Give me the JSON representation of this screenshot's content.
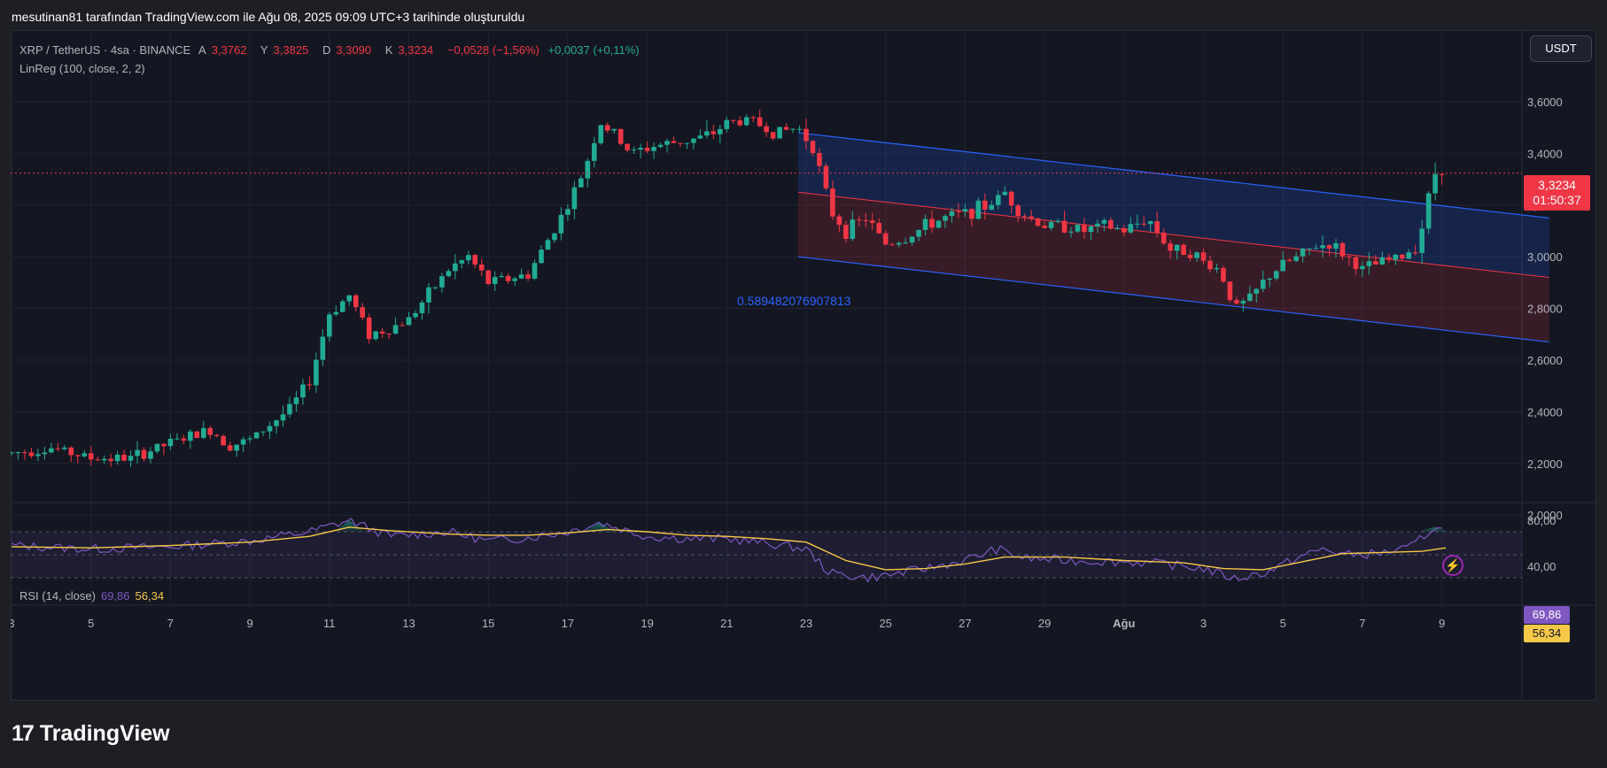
{
  "header": {
    "title": "mesutinan81 tarafından TradingView.com ile Ağu 08, 2025 09:09 UTC+3 tarihinde oluşturuldu"
  },
  "legend": {
    "symbol": "XRP / TetherUS · 4sa · BINANCE",
    "open_label": "A",
    "open": "3,3762",
    "high_label": "Y",
    "high": "3,3825",
    "low_label": "D",
    "low": "3,3090",
    "close_label": "K",
    "close": "3,3234",
    "change": "−0,0528 (−1,56%)",
    "volume_change": "+0,0037 (+0,11%)",
    "indicator": "LinReg (100, close, 2, 2)"
  },
  "currency_button": "USDT",
  "price_tag": {
    "price": "3,3234",
    "countdown": "01:50:37"
  },
  "channel_label": "0.589482076907813",
  "rsi": {
    "label": "RSI (14, close)",
    "value": "69,86",
    "ma": "56,34"
  },
  "footer": {
    "brand": "TradingView",
    "mark": "17"
  },
  "colors": {
    "up": "#22ab94",
    "down": "#f23645",
    "channel": "#2962ff",
    "rsi": "#7e57c2",
    "rsi_ma": "#f7c948",
    "background": "#141722"
  },
  "icons": {
    "alert": "lightning-bolt-icon"
  },
  "chart_data": {
    "type": "candlestick",
    "price_axis": {
      "ticks": [
        "3,6000",
        "3,4000",
        "3,2000",
        "3,0000",
        "2,8000",
        "2,6000",
        "2,4000",
        "2,2000",
        "2,0000"
      ],
      "range": [
        1.97,
        3.7
      ]
    },
    "x_axis": {
      "ticks": [
        "3",
        "5",
        "7",
        "9",
        "11",
        "13",
        "15",
        "17",
        "19",
        "21",
        "23",
        "25",
        "27",
        "29",
        "Ağu",
        "3",
        "5",
        "7",
        "9"
      ]
    },
    "rsi_axis": {
      "ticks": [
        "80,00",
        "40,00"
      ],
      "bands": [
        70,
        30
      ],
      "mid": 50
    },
    "price_path": [
      [
        3.0,
        2.24
      ],
      [
        4.0,
        2.26
      ],
      [
        5.0,
        2.22
      ],
      [
        6.0,
        2.22
      ],
      [
        6.5,
        2.25
      ],
      [
        7.0,
        2.28
      ],
      [
        8.0,
        2.33
      ],
      [
        8.5,
        2.27
      ],
      [
        9.0,
        2.29
      ],
      [
        10.0,
        2.41
      ],
      [
        10.5,
        2.52
      ],
      [
        11.0,
        2.78
      ],
      [
        11.5,
        2.85
      ],
      [
        12.0,
        2.7
      ],
      [
        12.5,
        2.72
      ],
      [
        13.0,
        2.76
      ],
      [
        14.0,
        2.95
      ],
      [
        14.5,
        3.0
      ],
      [
        15.0,
        2.9
      ],
      [
        16.0,
        2.93
      ],
      [
        17.0,
        3.2
      ],
      [
        17.4,
        3.33
      ],
      [
        17.8,
        3.52
      ],
      [
        18.2,
        3.47
      ],
      [
        18.6,
        3.4
      ],
      [
        19.2,
        3.43
      ],
      [
        20.0,
        3.45
      ],
      [
        20.6,
        3.47
      ],
      [
        21.0,
        3.52
      ],
      [
        21.6,
        3.53
      ],
      [
        22.2,
        3.48
      ],
      [
        22.8,
        3.5
      ],
      [
        23.2,
        3.42
      ],
      [
        23.6,
        3.18
      ],
      [
        24.0,
        3.1
      ],
      [
        24.5,
        3.15
      ],
      [
        25.0,
        3.05
      ],
      [
        25.5,
        3.07
      ],
      [
        26.0,
        3.12
      ],
      [
        26.5,
        3.15
      ],
      [
        27.0,
        3.17
      ],
      [
        27.6,
        3.2
      ],
      [
        28.0,
        3.25
      ],
      [
        28.4,
        3.17
      ],
      [
        29.0,
        3.12
      ],
      [
        29.5,
        3.12
      ],
      [
        30.0,
        3.1
      ],
      [
        30.5,
        3.12
      ],
      [
        31.0,
        3.1
      ],
      [
        31.6,
        3.15
      ],
      [
        32.2,
        3.02
      ],
      [
        32.6,
        3.03
      ],
      [
        33.0,
        2.98
      ],
      [
        33.4,
        2.95
      ],
      [
        33.8,
        2.8
      ],
      [
        34.2,
        2.84
      ],
      [
        34.6,
        2.92
      ],
      [
        35.0,
        2.97
      ],
      [
        35.4,
        3.0
      ],
      [
        35.8,
        3.04
      ],
      [
        36.2,
        3.05
      ],
      [
        36.6,
        3.0
      ],
      [
        37.0,
        2.95
      ],
      [
        37.5,
        2.98
      ],
      [
        38.0,
        3.0
      ],
      [
        38.4,
        3.05
      ],
      [
        38.8,
        3.32
      ],
      [
        39.1,
        3.36
      ]
    ],
    "lin_reg": {
      "start": [
        22.8,
        3.25
      ],
      "end": [
        41.7,
        2.92
      ],
      "upper_offset": 0.23,
      "lower_offset": 0.25
    },
    "rsi_path": [
      [
        3.0,
        58
      ],
      [
        5.0,
        55
      ],
      [
        7.0,
        57
      ],
      [
        9.0,
        62
      ],
      [
        10.5,
        70
      ],
      [
        11.5,
        80
      ],
      [
        12.5,
        66
      ],
      [
        14.0,
        70
      ],
      [
        15.0,
        62
      ],
      [
        16.0,
        65
      ],
      [
        17.0,
        70
      ],
      [
        17.8,
        78
      ],
      [
        19.0,
        66
      ],
      [
        20.0,
        64
      ],
      [
        21.0,
        64
      ],
      [
        22.0,
        60
      ],
      [
        23.0,
        55
      ],
      [
        23.6,
        34
      ],
      [
        24.5,
        30
      ],
      [
        25.0,
        32
      ],
      [
        26.0,
        38
      ],
      [
        27.0,
        45
      ],
      [
        27.8,
        55
      ],
      [
        28.5,
        47
      ],
      [
        29.5,
        45
      ],
      [
        31.0,
        44
      ],
      [
        32.0,
        42
      ],
      [
        33.0,
        38
      ],
      [
        33.8,
        29
      ],
      [
        34.6,
        35
      ],
      [
        35.4,
        48
      ],
      [
        36.0,
        55
      ],
      [
        36.6,
        50
      ],
      [
        37.4,
        51
      ],
      [
        38.2,
        56
      ],
      [
        38.8,
        74
      ],
      [
        39.1,
        70
      ]
    ],
    "rsi_ma_path": [
      [
        3.0,
        57
      ],
      [
        5.0,
        56
      ],
      [
        7.0,
        58
      ],
      [
        9.0,
        61
      ],
      [
        10.5,
        66
      ],
      [
        11.5,
        74
      ],
      [
        12.5,
        71
      ],
      [
        14.0,
        68
      ],
      [
        15.0,
        67
      ],
      [
        16.0,
        67
      ],
      [
        17.0,
        69
      ],
      [
        18.0,
        72
      ],
      [
        19.0,
        70
      ],
      [
        20.0,
        67
      ],
      [
        21.0,
        66
      ],
      [
        22.0,
        64
      ],
      [
        23.0,
        61
      ],
      [
        24.0,
        45
      ],
      [
        25.0,
        37
      ],
      [
        26.0,
        38
      ],
      [
        27.0,
        42
      ],
      [
        28.0,
        48
      ],
      [
        29.5,
        48
      ],
      [
        31.0,
        45
      ],
      [
        32.5,
        43
      ],
      [
        33.5,
        38
      ],
      [
        34.5,
        37
      ],
      [
        35.5,
        44
      ],
      [
        36.5,
        51
      ],
      [
        37.5,
        52
      ],
      [
        38.5,
        53
      ],
      [
        39.1,
        56
      ]
    ]
  }
}
